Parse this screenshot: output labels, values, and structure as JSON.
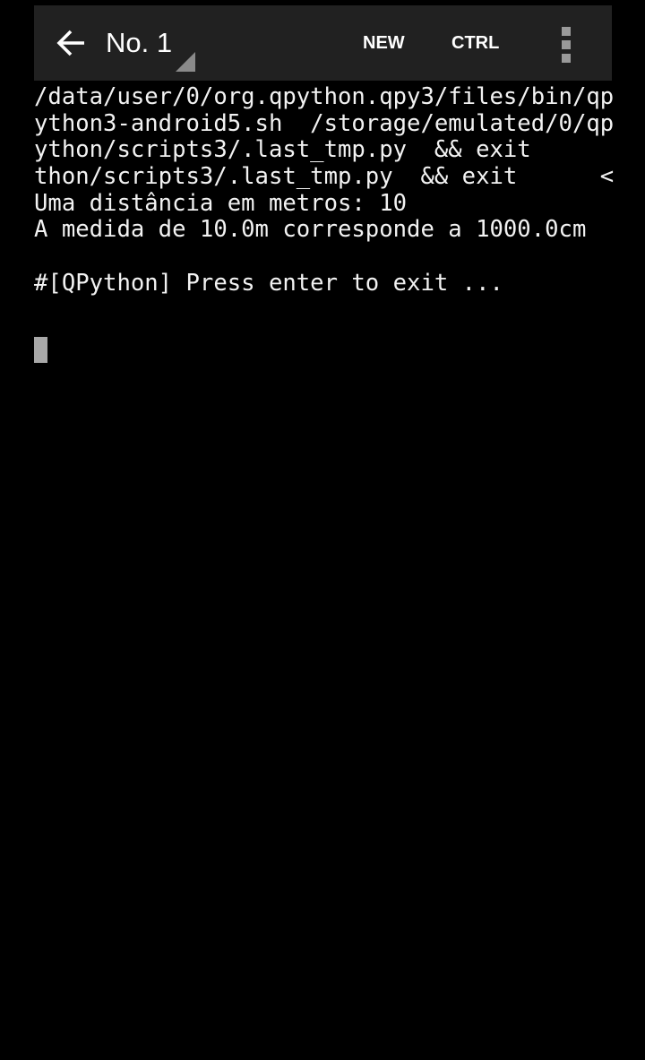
{
  "toolbar": {
    "back_icon": "arrow-left-icon",
    "session_title": "No. 1",
    "new_label": "NEW",
    "ctrl_label": "CTRL",
    "overflow_icon": "more-vert-icon",
    "background": "#212121"
  },
  "terminal": {
    "lines": [
      "/data/user/0/org.qpython.qpy3/files/bin/qp",
      "ython3-android5.sh  /storage/emulated/0/qp",
      "ython/scripts3/.last_tmp.py  && exit",
      "thon/scripts3/.last_tmp.py  && exit      <",
      "Uma distância em metros: 10",
      "A medida de 10.0m corresponde a 1000.0cm",
      "",
      "#[QPython] Press enter to exit ...",
      ""
    ],
    "text_color": "#f2f2f2",
    "background": "#000000",
    "cursor_color": "#a8a8a8"
  }
}
